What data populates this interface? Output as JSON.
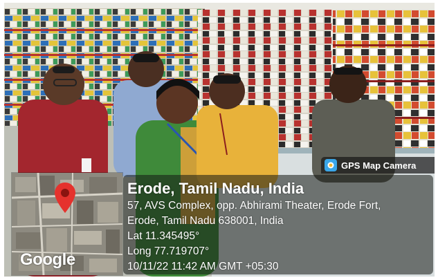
{
  "photo": {
    "description_icon": "shop-photo-group"
  },
  "gps_overlay": {
    "badge_label": "GPS Map Camera",
    "badge_icon": "camera-icon",
    "map_icon": "map-pin-icon",
    "map_logo": "Google",
    "location_title": "Erode, Tamil Nadu, India",
    "address_line_1": "57, AVS Complex, opp. Abhirami Theater, Erode Fort,",
    "address_line_2": "Erode, Tamil Nadu 638001, India",
    "latitude": "Lat 11.345495°",
    "longitude": "Long 77.719707°",
    "timestamp": "10/11/22 11:42 AM GMT +05:30",
    "pin_color": "#e5322d"
  }
}
